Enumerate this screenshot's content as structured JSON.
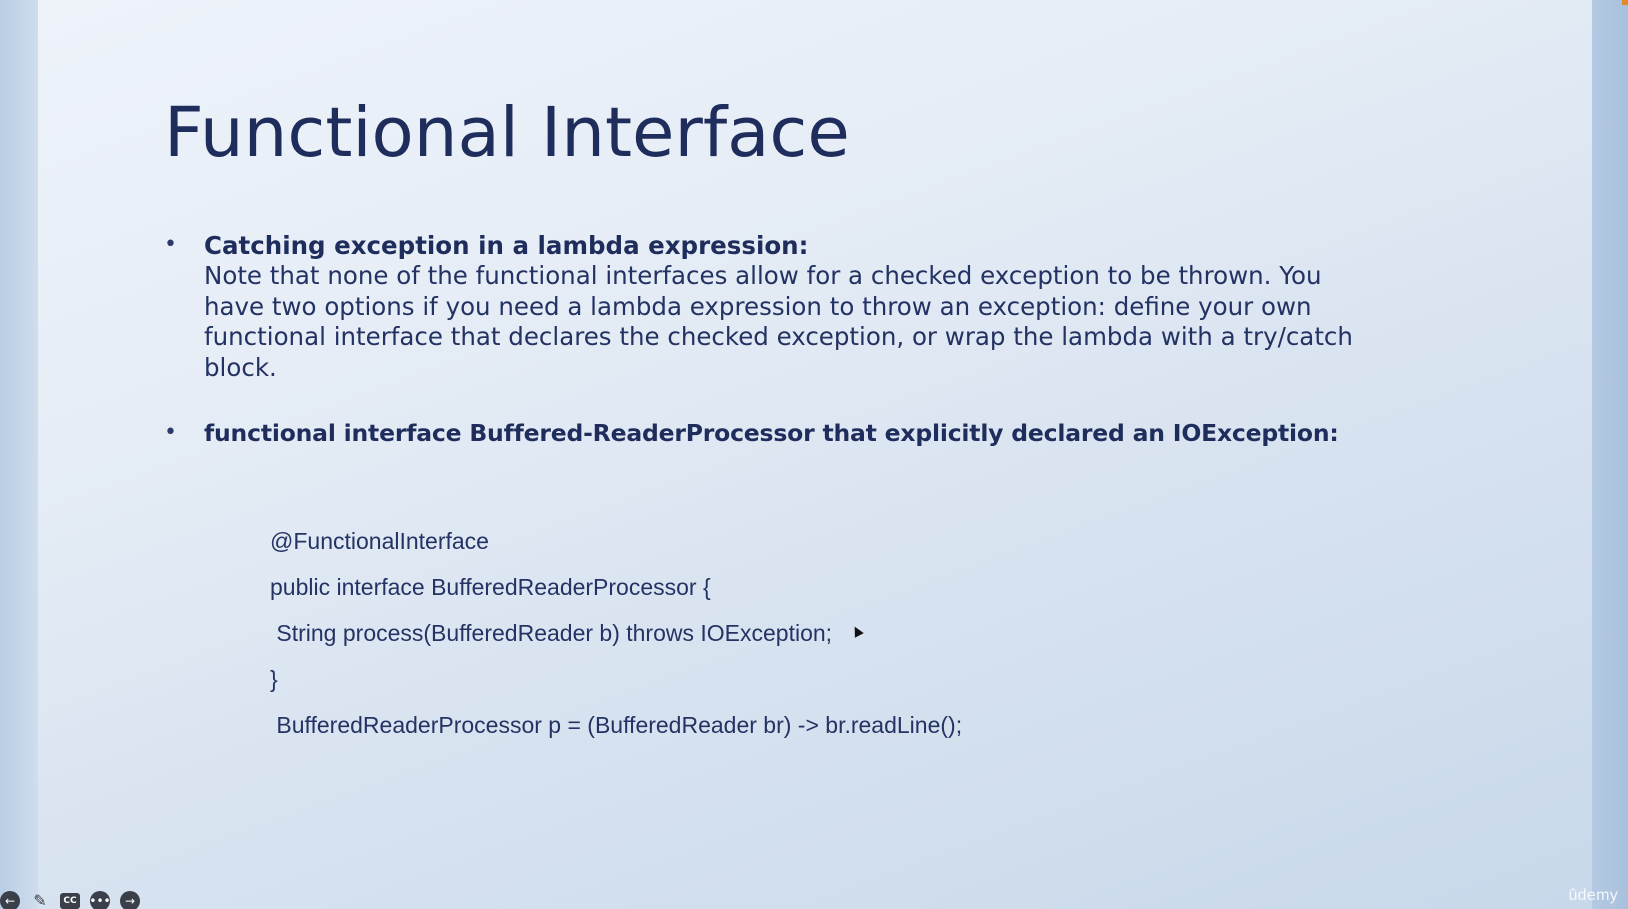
{
  "slide": {
    "title": "Functional Interface",
    "bullets": [
      {
        "heading": "Catching exception in a lambda expression:",
        "body_lines": [
          "Note that none of the functional interfaces allow for a checked exception to be thrown. You",
          "have two options if you need a lambda expression to throw an exception: define your own",
          "functional interface that declares the checked exception, or wrap the lambda with a try/catch",
          "block."
        ]
      },
      {
        "heading": "functional interface Buffered-ReaderProcessor that explicitly declared an IOException:"
      }
    ],
    "code_lines": [
      "@FunctionalInterface",
      "public interface BufferedReaderProcessor {",
      " String process(BufferedReader b) throws IOException;",
      "}",
      " BufferedReaderProcessor p = (BufferedReader br) -> br.readLine();"
    ],
    "bullet_symbol": "•"
  },
  "player": {
    "controls": [
      {
        "name": "back-icon",
        "glyph": "←"
      },
      {
        "name": "pen-icon",
        "glyph": "✎"
      },
      {
        "name": "captions-icon",
        "glyph": "CC"
      },
      {
        "name": "more-icon",
        "glyph": "•••"
      },
      {
        "name": "forward-icon",
        "glyph": "→"
      }
    ],
    "watermark": "ûdemy"
  },
  "colors": {
    "title": "#1f2d5c",
    "text": "#233262",
    "accent_corner": "#e08a2a"
  }
}
